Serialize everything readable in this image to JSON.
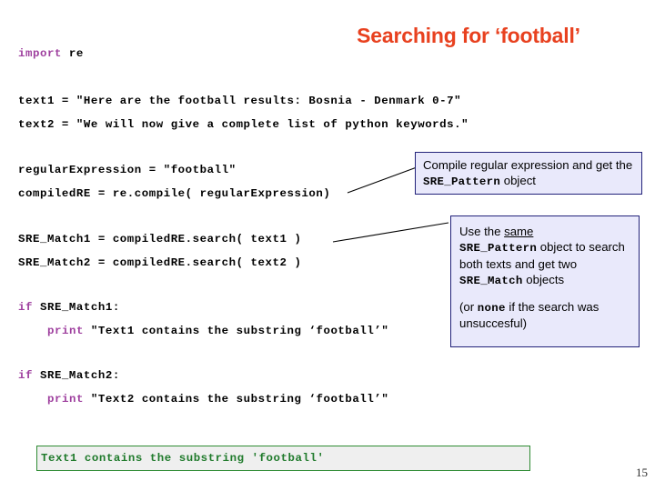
{
  "slide": {
    "title": "Searching for ‘football’",
    "page_number": "15",
    "title_color": "#e8411f",
    "keyword_color": "#9e3f9e",
    "callout_bg": "#e9e9fb",
    "callout_border": "#22227a",
    "output_text_color": "#1f7a2b",
    "output_border_color": "#2e8b33",
    "output_bg": "#efefef"
  },
  "code": {
    "import_keyword": "import",
    "import_module": " re",
    "text1": "text1 = \"Here are the football results: Bosnia - Denmark 0-7\"",
    "text2": "text2 = \"We will now give a complete list of python keywords.\"",
    "regular_expression": "regularExpression = \"football\"",
    "compiled_re": "compiledRE = re.compile( regularExpression)",
    "sre_match1": "SRE_Match1 = compiledRE.search( text1 )",
    "sre_match2": "SRE_Match2 = compiledRE.search( text2 )",
    "if1_keyword": "if",
    "if1_rest": " SRE_Match1:",
    "print1_keyword": "print",
    "print1_rest": " \"Text1 contains the substring ‘football’\"",
    "if2_keyword": "if",
    "if2_rest": " SRE_Match2:",
    "print2_keyword": "print",
    "print2_rest": " \"Text2 contains the substring ‘football’\""
  },
  "callouts": {
    "compile": {
      "part1": "Compile regular expression and get the ",
      "mono1": "SRE_Pattern",
      "part2": " object"
    },
    "reuse": {
      "line1_a": "Use the ",
      "line1_underline": "same",
      "mono1": "SRE_Pattern",
      "line2_b": " object to search both texts and get two ",
      "mono2": "SRE_Match",
      "line2_c": " objects",
      "line3_a": "(or ",
      "mono3": "none",
      "line3_b": " if the search was unsuccesful)"
    }
  },
  "output": {
    "console_line": "Text1 contains the substring 'football'"
  }
}
